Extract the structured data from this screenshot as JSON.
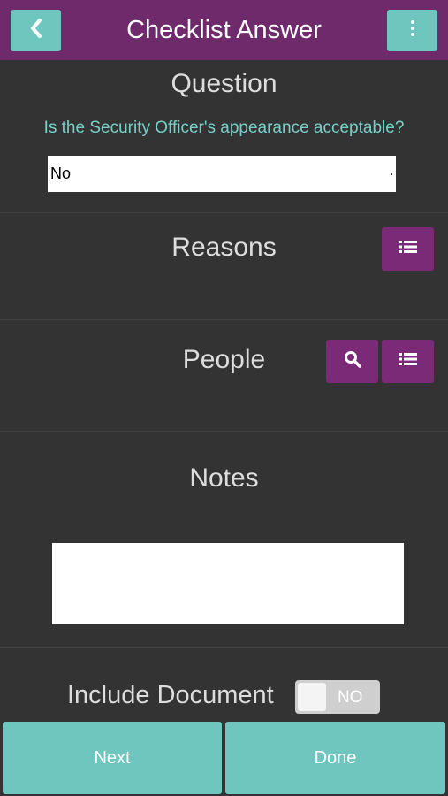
{
  "header": {
    "title": "Checklist Answer",
    "back_icon": "chevron-left-icon",
    "menu_icon": "more-vertical-icon"
  },
  "question": {
    "heading": "Question",
    "text": "Is the Security Officer's appearance acceptable?",
    "selected_answer": "No"
  },
  "reasons": {
    "heading": "Reasons",
    "list_icon": "list-icon"
  },
  "people": {
    "heading": "People",
    "search_icon": "search-icon",
    "list_icon": "list-icon"
  },
  "notes": {
    "heading": "Notes",
    "value": ""
  },
  "include_document": {
    "label": "Include Document",
    "toggle_text": "NO"
  },
  "footer": {
    "next_label": "Next",
    "done_label": "Done"
  },
  "colors": {
    "header_bg": "#6e2a6b",
    "accent_teal": "#6fc6bf",
    "button_purple": "#7b2a78",
    "background": "#333333",
    "question_text": "#79cfc6"
  }
}
